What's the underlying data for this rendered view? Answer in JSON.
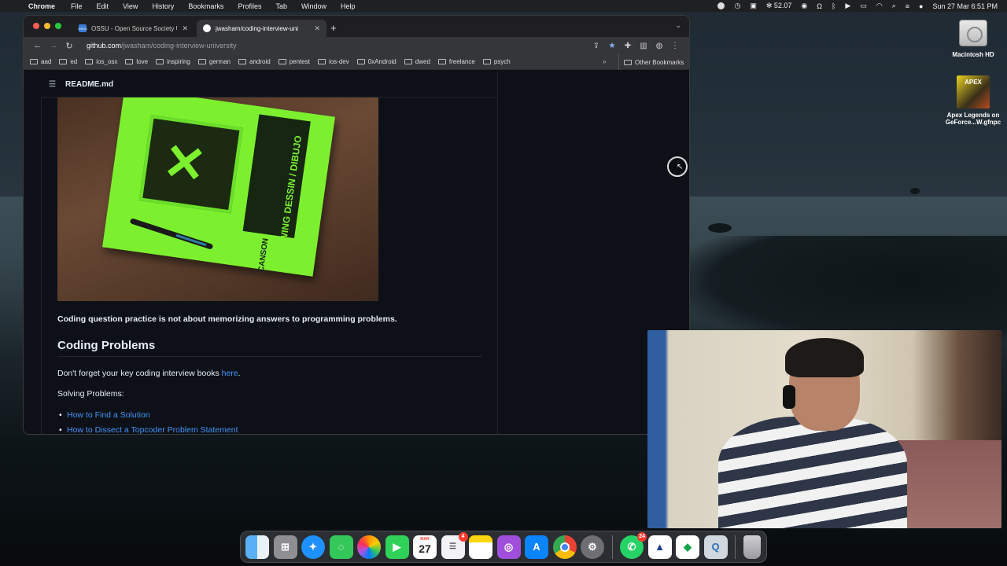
{
  "menubar": {
    "app_name": "Chrome",
    "items": [
      "File",
      "Edit",
      "View",
      "History",
      "Bookmarks",
      "Profiles",
      "Tab",
      "Window",
      "Help"
    ],
    "temperature": "52.07",
    "datetime": "Sun 27 Mar  6:51 PM"
  },
  "desktop": {
    "icons": [
      {
        "label": "Macintosh HD"
      },
      {
        "label": "Apex Legends on GeForce...W.gfnpc",
        "thumb_text": "APEX"
      }
    ]
  },
  "browser": {
    "tabs": [
      {
        "title": "OSSU - Open Source Society U",
        "favicon_text": "OSSU",
        "active": false
      },
      {
        "title": "jwasham/coding-interview-uni",
        "active": true
      }
    ],
    "url_host": "github.com",
    "url_path": "/jwasham/coding-interview-university",
    "bookmarks": [
      "aad",
      "ed",
      "ios_osx",
      "love",
      "inspiring",
      "german",
      "android",
      "pentest",
      "ios-dev",
      "0xAndroid",
      "dwed",
      "freelance",
      "psych"
    ],
    "bookmarks_overflow": "»",
    "other_bookmarks": "Other Bookmarks"
  },
  "readme": {
    "file_name": "README.md",
    "image_text": {
      "band": "DRAWING DESSIN / DIBUJO",
      "brand": "CANSON"
    },
    "paragraph_bold": "Coding question practice is not about memorizing answers to programming problems.",
    "heading": "Coding Problems",
    "books_text": "Don't forget your key coding interview books ",
    "books_link": "here",
    "books_tail": ".",
    "solving_label": "Solving Problems:",
    "links": [
      "How to Find a Solution",
      "How to Dissect a Topcoder Problem Statement"
    ]
  },
  "dock": {
    "calendar_month": "MAR",
    "calendar_day": "27",
    "reminders_badge": "4",
    "whatsapp_badge": "24"
  },
  "colors": {
    "github_bg": "#0d1117",
    "link": "#4493f8",
    "text": "#e6edf3"
  }
}
